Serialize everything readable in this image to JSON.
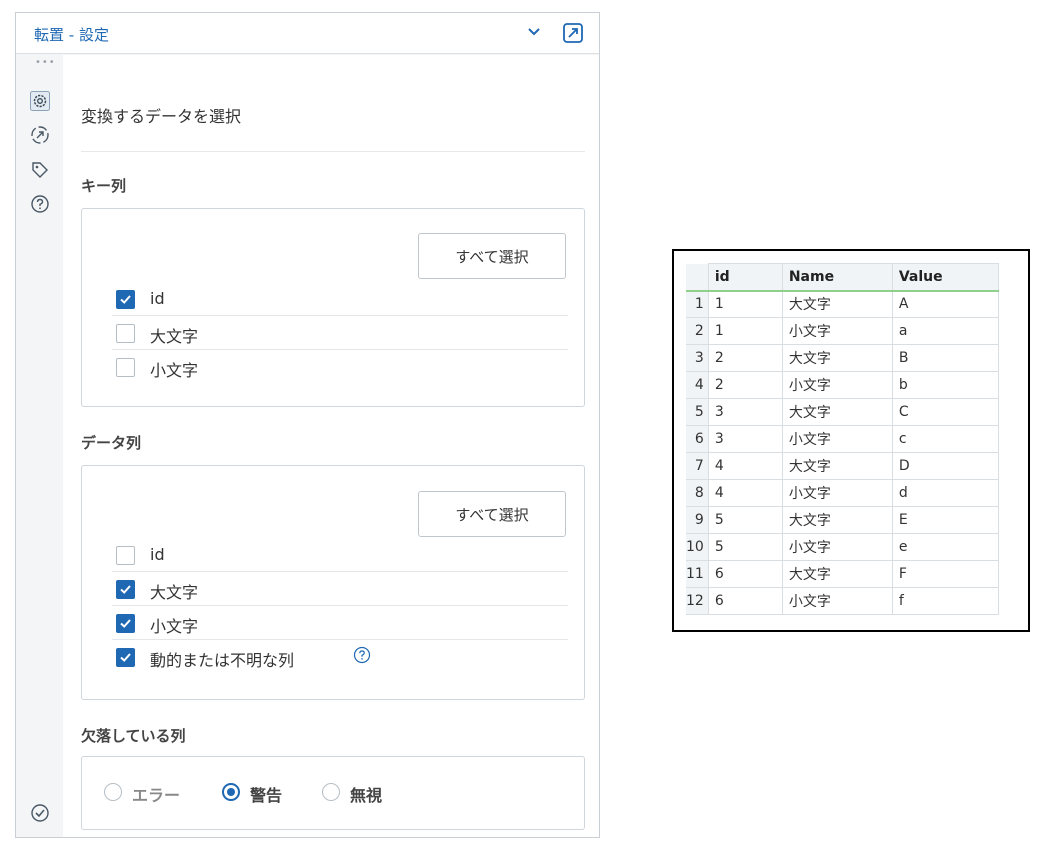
{
  "panel": {
    "title": "転置 - 設定",
    "heading": "変換するデータを選択",
    "key_section": {
      "title": "キー列",
      "select_all": "すべて選択",
      "items": [
        {
          "label": "id",
          "checked": true
        },
        {
          "label": "大文字",
          "checked": false
        },
        {
          "label": "小文字",
          "checked": false
        }
      ]
    },
    "data_section": {
      "title": "データ列",
      "select_all": "すべて選択",
      "items": [
        {
          "label": "id",
          "checked": false
        },
        {
          "label": "大文字",
          "checked": true
        },
        {
          "label": "小文字",
          "checked": true
        },
        {
          "label": "動的または不明な列",
          "checked": true
        }
      ]
    },
    "missing_section": {
      "title": "欠落している列",
      "options": [
        {
          "label": "エラー",
          "selected": false
        },
        {
          "label": "警告",
          "selected": true
        },
        {
          "label": "無視",
          "selected": false
        }
      ]
    },
    "toolbar_icons": [
      "settings-icon",
      "navigate-icon",
      "tag-icon",
      "help-icon",
      "check-icon"
    ]
  },
  "table": {
    "columns": [
      "id",
      "Name",
      "Value"
    ],
    "rows": [
      {
        "n": "1",
        "id": "1",
        "name": "大文字",
        "value": "A"
      },
      {
        "n": "2",
        "id": "1",
        "name": "小文字",
        "value": "a"
      },
      {
        "n": "3",
        "id": "2",
        "name": "大文字",
        "value": "B"
      },
      {
        "n": "4",
        "id": "2",
        "name": "小文字",
        "value": "b"
      },
      {
        "n": "5",
        "id": "3",
        "name": "大文字",
        "value": "C"
      },
      {
        "n": "6",
        "id": "3",
        "name": "小文字",
        "value": "c"
      },
      {
        "n": "7",
        "id": "4",
        "name": "大文字",
        "value": "D"
      },
      {
        "n": "8",
        "id": "4",
        "name": "小文字",
        "value": "d"
      },
      {
        "n": "9",
        "id": "5",
        "name": "大文字",
        "value": "E"
      },
      {
        "n": "10",
        "id": "5",
        "name": "小文字",
        "value": "e"
      },
      {
        "n": "11",
        "id": "6",
        "name": "大文字",
        "value": "F"
      },
      {
        "n": "12",
        "id": "6",
        "name": "小文字",
        "value": "f"
      }
    ]
  },
  "colors": {
    "accent": "#1f68b4",
    "header_underline": "#8fd18a",
    "panel_bg": "#f3f5f6"
  }
}
